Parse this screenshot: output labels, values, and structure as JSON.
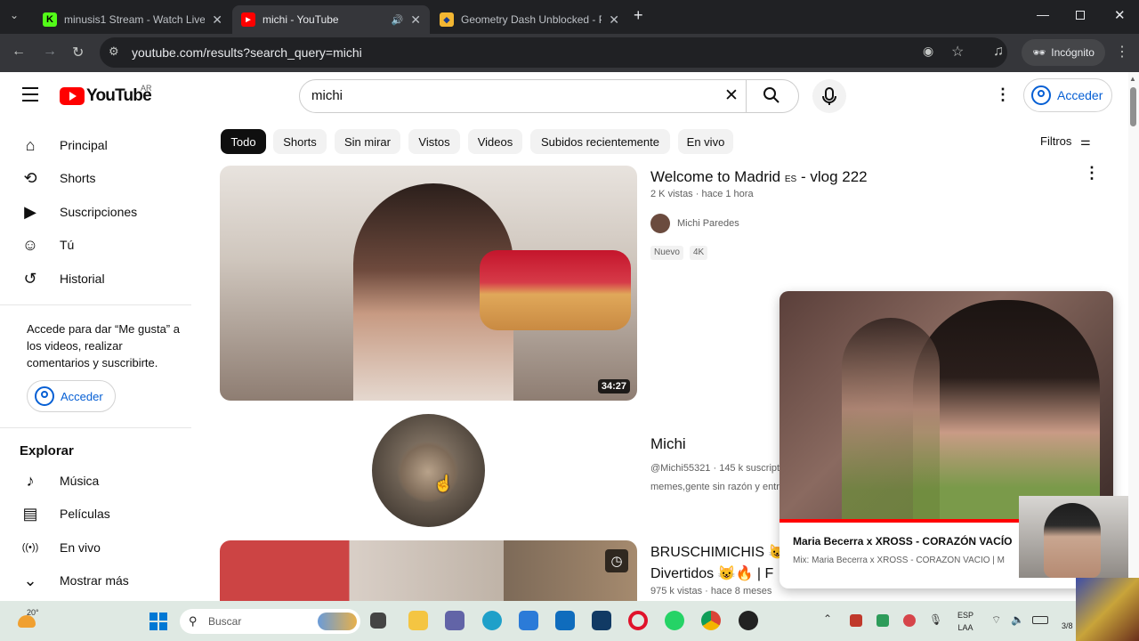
{
  "browser": {
    "tabs": [
      {
        "title": "minusis1 Stream - Watch Live o",
        "favicon": "K",
        "color": "#53fc18"
      },
      {
        "title": "michi - YouTube",
        "favicon": "yt",
        "color": "#ff0000"
      },
      {
        "title": "Geometry Dash Unblocked - Pl",
        "favicon": "gd",
        "color": "#f2b632"
      }
    ],
    "url": "youtube.com/results?search_query=michi",
    "incognito_label": "Incógnito"
  },
  "youtube": {
    "logo_text": "YouTube",
    "country_code": "AR",
    "search_value": "michi",
    "signin_label": "Acceder",
    "sidebar": {
      "items": [
        {
          "label": "Principal",
          "icon": "home-icon",
          "glyph": "⌂"
        },
        {
          "label": "Shorts",
          "icon": "shorts-icon",
          "glyph": "⟲"
        },
        {
          "label": "Suscripciones",
          "icon": "subscriptions-icon",
          "glyph": "▶"
        },
        {
          "label": "Tú",
          "icon": "user-icon",
          "glyph": "☺"
        },
        {
          "label": "Historial",
          "icon": "history-icon",
          "glyph": "↺"
        }
      ],
      "signin_message": "Accede para dar “Me gusta” a los videos, realizar comentarios y suscribirte.",
      "signin_label": "Acceder",
      "explore_title": "Explorar",
      "explore_items": [
        {
          "label": "Música",
          "icon": "music-icon",
          "glyph": "♪"
        },
        {
          "label": "Películas",
          "icon": "film-icon",
          "glyph": "▤"
        },
        {
          "label": "En vivo",
          "icon": "live-icon",
          "glyph": "((•))"
        },
        {
          "label": "Mostrar más",
          "icon": "chevron-down-icon",
          "glyph": "⌄"
        }
      ]
    },
    "chips": [
      "Todo",
      "Shorts",
      "Sin mirar",
      "Vistos",
      "Videos",
      "Subidos recientemente",
      "En vivo"
    ],
    "filters_label": "Filtros",
    "results": {
      "video1": {
        "title": "Welcome to Madrid",
        "title_es": "ES",
        "title_suffix": " - vlog 222",
        "meta": "2 K vistas · hace 1 hora",
        "channel": "Michi Paredes",
        "badges": [
          "Nuevo",
          "4K"
        ],
        "duration": "34:27"
      },
      "channel": {
        "name": "Michi",
        "meta": "@Michi55321 · 145 k suscriptores",
        "description": "memes,gente sin razón y entretenimiento"
      },
      "video2": {
        "title_line1": "BRUSCHIMICHIS 😺",
        "title_line2": "Divertidos 😺🔥 | F",
        "meta": "975 k vistas · hace 8 meses"
      }
    },
    "miniplayer": {
      "title": "Maria Becerra x XROSS - CORAZÓN VACÍO",
      "subtitle": "Mix: Maria Becerra x XROSS - CORAZÓN VACÍO | M",
      "progress": 0.72
    }
  },
  "taskbar": {
    "temperature": "20°",
    "search_placeholder": "Buscar",
    "lang_line1": "ESP",
    "lang_line2": "LAA",
    "clock": "3/8"
  }
}
